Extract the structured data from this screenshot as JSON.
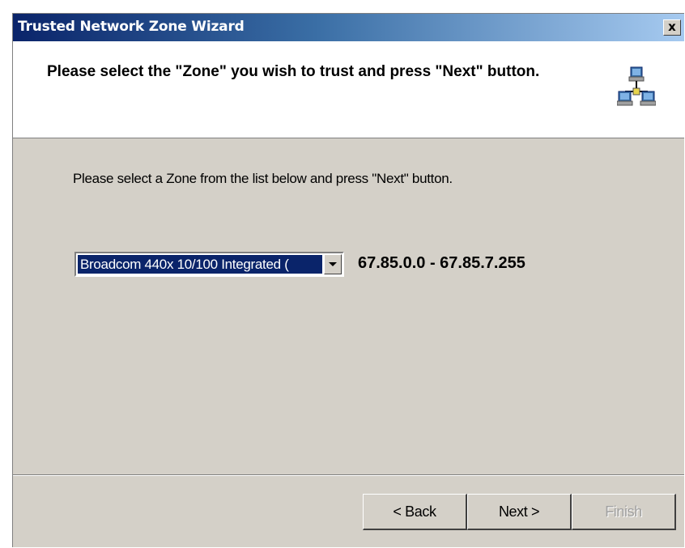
{
  "window": {
    "title": "Trusted Network Zone Wizard",
    "close_label": "x"
  },
  "header": {
    "title": "Please select the \"Zone\" you wish to trust and press \"Next\" button.",
    "icon": "network-computers-icon"
  },
  "body": {
    "instruction": "Please select a Zone from the list below and press \"Next\" button.",
    "zone_select": {
      "selected": "Broadcom 440x 10/100 Integrated (",
      "icon": "chevron-down-icon"
    },
    "ip_range": "67.85.0.0 - 67.85.7.255"
  },
  "buttons": {
    "back": "< Back",
    "next": "Next >",
    "finish": "Finish"
  },
  "colors": {
    "titlebar_start": "#0a246a",
    "titlebar_end": "#a6caf0",
    "dialog_bg": "#d4d0c8",
    "selection_bg": "#0a246a"
  }
}
